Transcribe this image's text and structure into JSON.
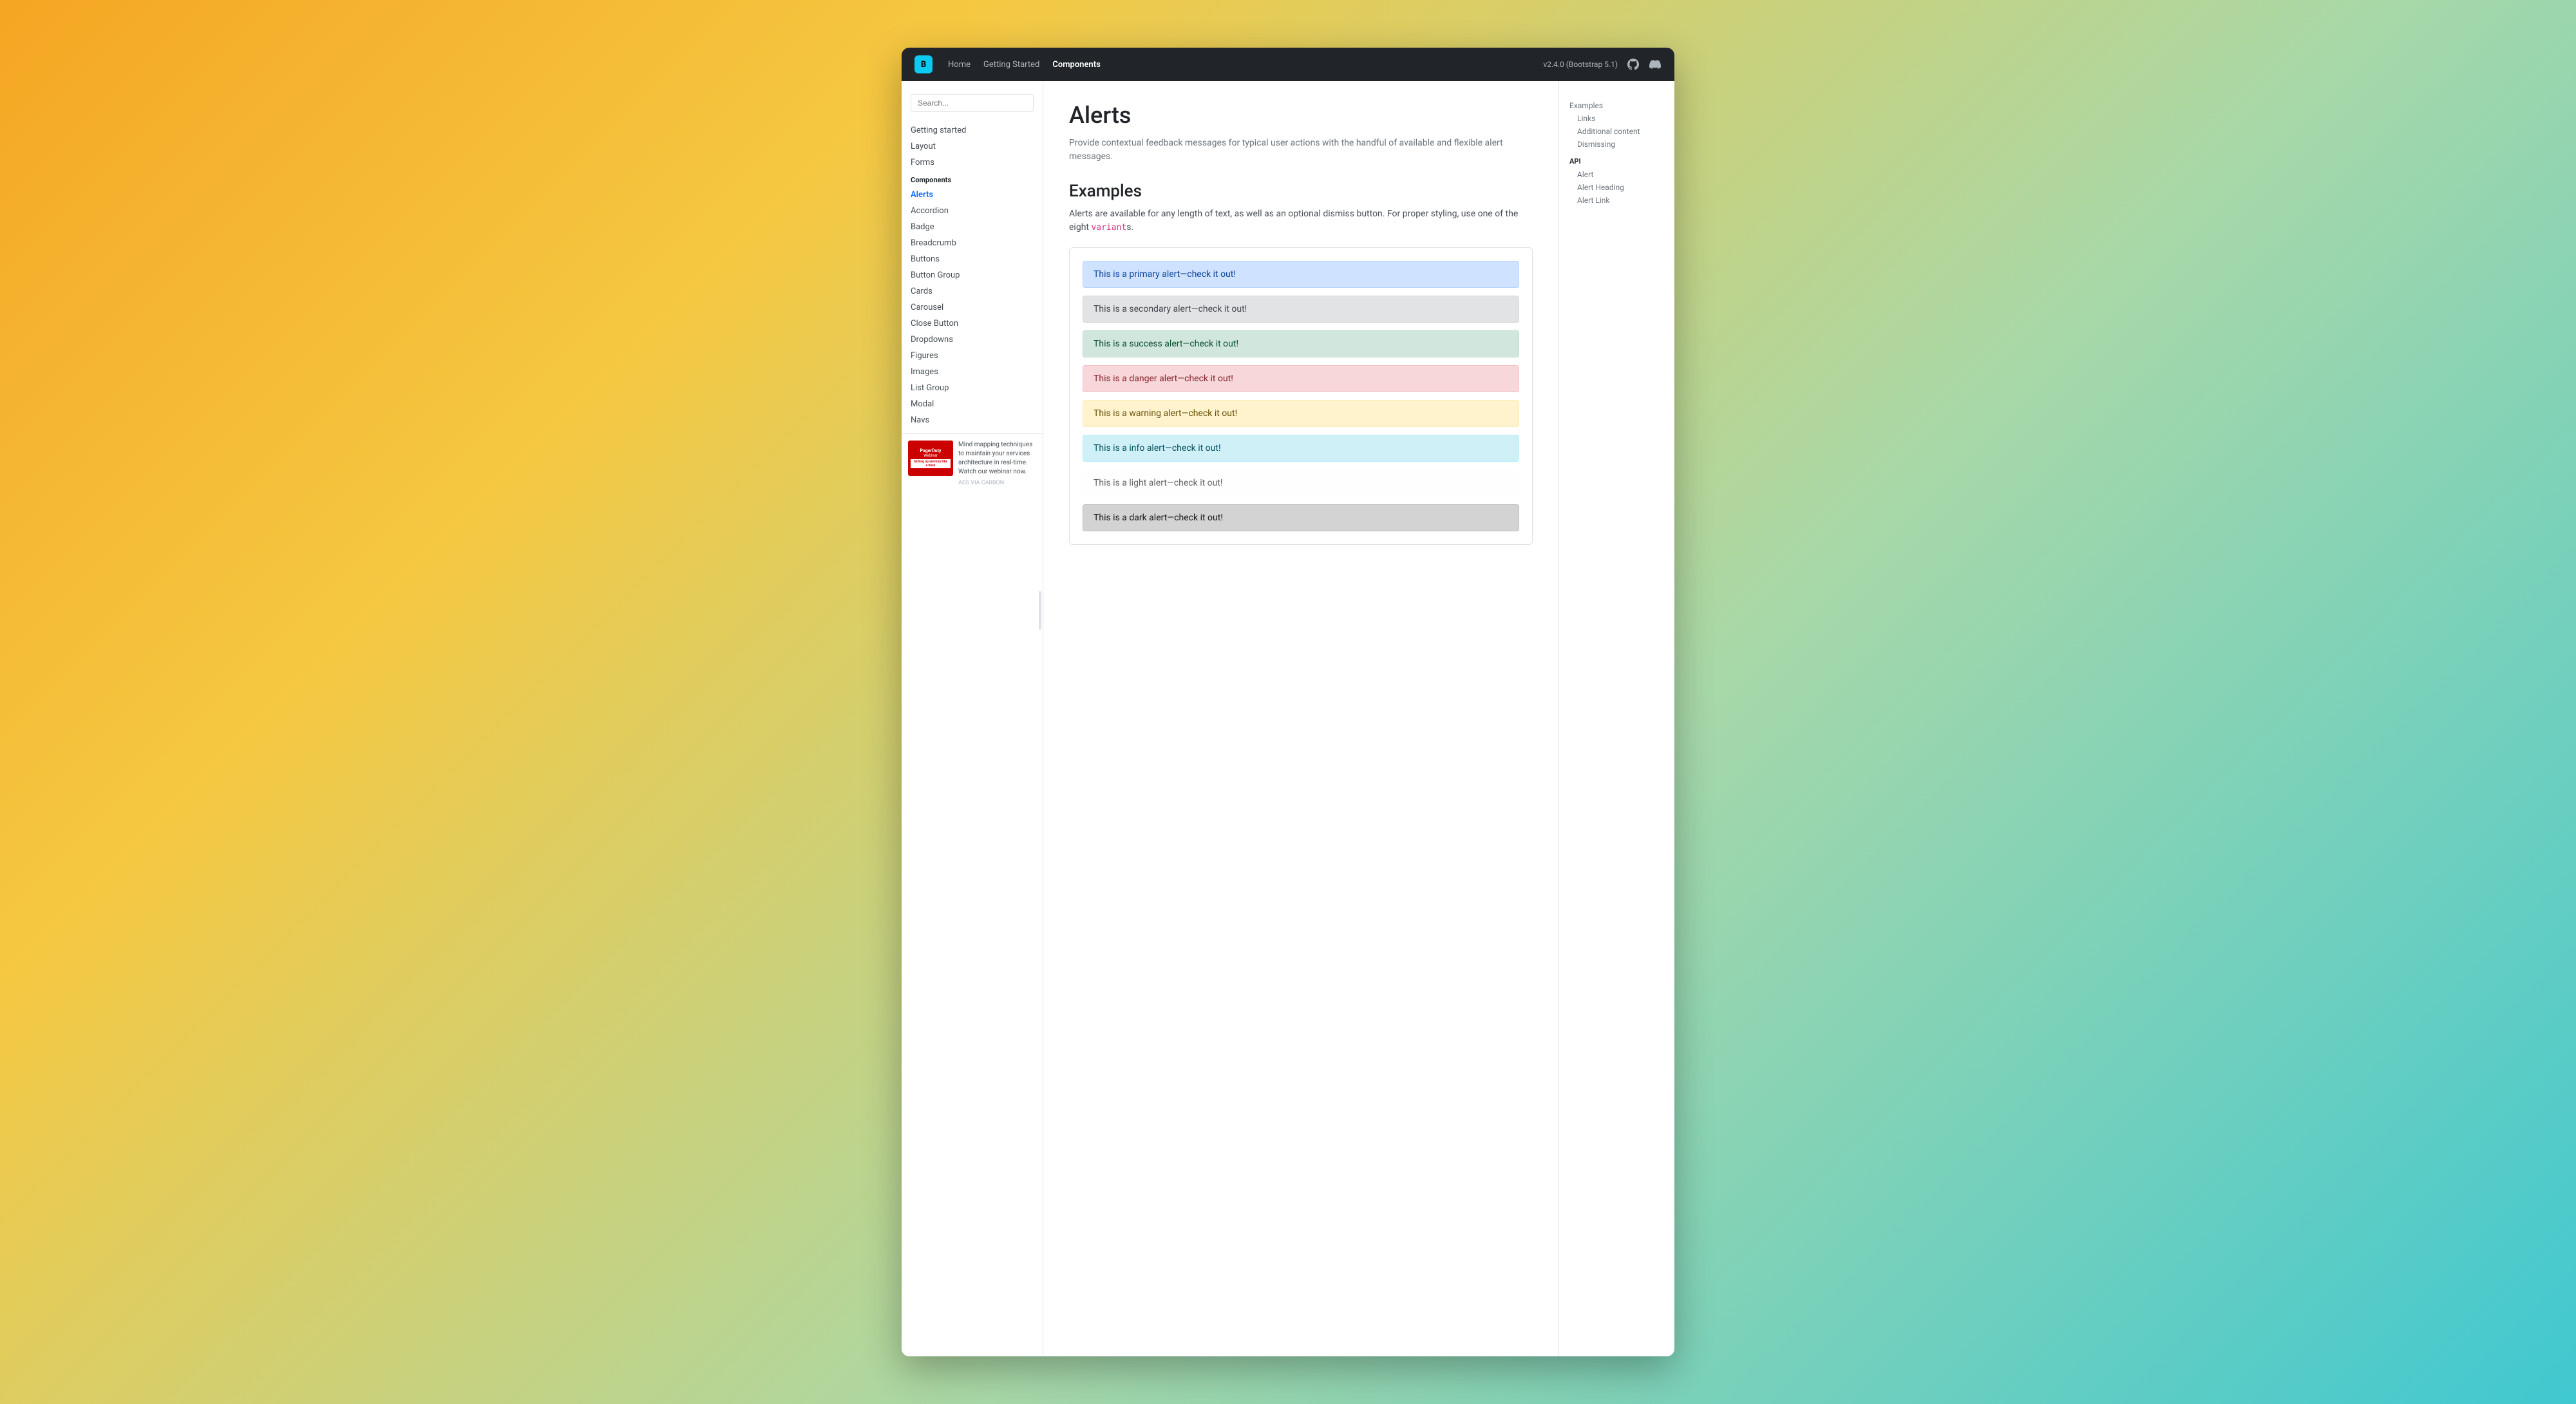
{
  "navbar": {
    "brand_icon": "B",
    "links": [
      {
        "label": "Home",
        "active": false
      },
      {
        "label": "Getting Started",
        "active": false
      },
      {
        "label": "Components",
        "active": true
      }
    ],
    "version": "v2.4.0 (Bootstrap 5.1)",
    "github_label": "GitHub icon",
    "discord_label": "Discord icon"
  },
  "sidebar": {
    "search_placeholder": "Search...",
    "sections": [
      {
        "items": [
          {
            "label": "Getting started",
            "active": false
          },
          {
            "label": "Layout",
            "active": false
          },
          {
            "label": "Forms",
            "active": false
          }
        ]
      },
      {
        "section_label": "Components",
        "items": [
          {
            "label": "Alerts",
            "active": true
          },
          {
            "label": "Accordion",
            "active": false
          },
          {
            "label": "Badge",
            "active": false
          },
          {
            "label": "Breadcrumb",
            "active": false
          },
          {
            "label": "Buttons",
            "active": false
          },
          {
            "label": "Button Group",
            "active": false
          },
          {
            "label": "Cards",
            "active": false
          },
          {
            "label": "Carousel",
            "active": false
          },
          {
            "label": "Close Button",
            "active": false
          },
          {
            "label": "Dropdowns",
            "active": false
          },
          {
            "label": "Figures",
            "active": false
          },
          {
            "label": "Images",
            "active": false
          },
          {
            "label": "List Group",
            "active": false
          },
          {
            "label": "Modal",
            "active": false
          },
          {
            "label": "Navs",
            "active": false
          }
        ]
      }
    ],
    "ad": {
      "brand": "PagerDuty",
      "type": "Webinar",
      "title": "Setting up services like a boss",
      "description": "Mind mapping techniques to maintain your services architecture in real-time. Watch our webinar now.",
      "ads_label": "ADS VIA CARBON"
    }
  },
  "main": {
    "page_title": "Alerts",
    "page_description": "Provide contextual feedback messages for typical user actions with the handful of available and flexible alert messages.",
    "examples_section": {
      "title": "Examples",
      "description_start": "Alerts are available for any length of text, as well as an optional dismiss button. For proper styling, use one of the eight ",
      "code": "variant",
      "description_end": "s.",
      "alerts": [
        {
          "type": "primary",
          "text": "This is a primary alert—check it out!"
        },
        {
          "type": "secondary",
          "text": "This is a secondary alert—check it out!"
        },
        {
          "type": "success",
          "text": "This is a success alert—check it out!"
        },
        {
          "type": "danger",
          "text": "This is a danger alert—check it out!"
        },
        {
          "type": "warning",
          "text": "This is a warning alert—check it out!"
        },
        {
          "type": "info",
          "text": "This is a info alert—check it out!"
        },
        {
          "type": "light",
          "text": "This is a light alert—check it out!"
        },
        {
          "type": "dark",
          "text": "This is a dark alert—check it out!"
        }
      ]
    }
  },
  "toc": {
    "sections": [
      {
        "items": [
          {
            "label": "Examples",
            "sub": false
          },
          {
            "label": "Links",
            "sub": true
          },
          {
            "label": "Additional content",
            "sub": true
          },
          {
            "label": "Dismissing",
            "sub": true
          }
        ]
      },
      {
        "section_label": "API",
        "items": [
          {
            "label": "Alert",
            "sub": true
          },
          {
            "label": "Alert Heading",
            "sub": true
          },
          {
            "label": "Alert Link",
            "sub": true
          }
        ]
      }
    ]
  }
}
